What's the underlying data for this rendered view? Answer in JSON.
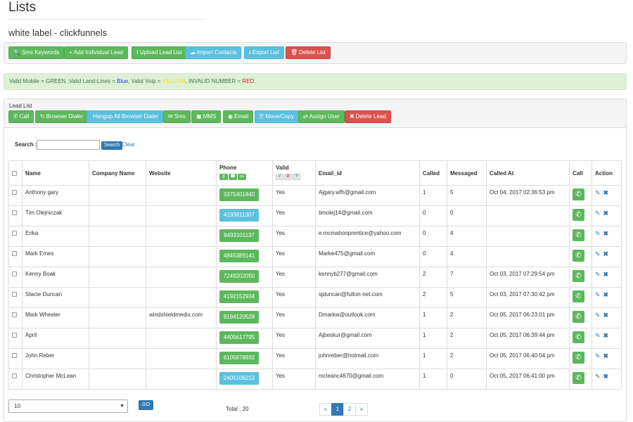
{
  "page": {
    "title": "Lists",
    "subtitle": "white label - clickfunnels"
  },
  "toolbar": [
    {
      "label": "Sms Keywords",
      "icon": "🔍",
      "color": "green"
    },
    {
      "label": "Add Individual Lead",
      "icon": "+",
      "color": "green"
    },
    {
      "label": "Upload Lead List",
      "icon": "⭱",
      "color": "green"
    },
    {
      "label": "Import Contacts",
      "icon": "☁",
      "color": "blue"
    },
    {
      "label": "Export List",
      "icon": "⭳",
      "color": "blue"
    },
    {
      "label": "Delete List",
      "icon": "🗑",
      "color": "red"
    }
  ],
  "legend": {
    "part1": "Valid Mobile = GREEN ,Valid Land-Lines = ",
    "blue": "Blue",
    "part2": ", Valid Voip = ",
    "yellow": "YELLOW",
    "part3": ", INVALID NUMBER = ",
    "red": "RED."
  },
  "lead_list": {
    "label": "Lead List",
    "buttons": [
      {
        "label": "Call",
        "icon": "✆",
        "color": "green"
      },
      {
        "label": "Browser Dialer",
        "icon": "↻",
        "color": "green"
      },
      {
        "label": "Hangup All Browser Dialer",
        "icon": "",
        "color": "blue"
      },
      {
        "label": "Sms",
        "icon": "✉",
        "color": "green"
      },
      {
        "label": "MMS",
        "icon": "▣",
        "color": "green"
      },
      {
        "label": "Email",
        "icon": "◉",
        "color": "green"
      },
      {
        "label": "Move/Copy",
        "icon": "⎘",
        "color": "blue"
      },
      {
        "label": "Assign User",
        "icon": "⇄",
        "color": "green"
      },
      {
        "label": "Delete Lead",
        "icon": "✖",
        "color": "red"
      }
    ]
  },
  "search": {
    "label": "Search :",
    "value": "",
    "button": "Search",
    "clear": "Clear"
  },
  "table": {
    "headers": {
      "name": "Name",
      "company": "Company Name",
      "website": "Website",
      "phone": "Phone",
      "valid": "Valid",
      "email": "Email_id",
      "called": "Called",
      "messaged": "Messaged",
      "called_at": "Called At",
      "call": "Call",
      "action": "Action"
    },
    "rows": [
      {
        "name": "Anthony gary",
        "company": "",
        "website": "",
        "phone": "3375401840",
        "phone_color": "#5cb85c",
        "valid": "Yes",
        "email": "Ajgary.wfh@gmail.com",
        "called": "1",
        "messaged": "5",
        "called_at": "Oct 04, 2017 02:36:53 pm"
      },
      {
        "name": "Tim Olejniczak",
        "company": "",
        "website": "",
        "phone": "4193811307",
        "phone_color": "#5bc0de",
        "valid": "Yes",
        "email": "timolej14@gmail.com",
        "called": "0",
        "messaged": "0",
        "called_at": ""
      },
      {
        "name": "Erika",
        "company": "",
        "website": "",
        "phone": "9493101137",
        "phone_color": "#5cb85c",
        "valid": "Yes",
        "email": "e.mcmahonprentice@yahoo.com",
        "called": "0",
        "messaged": "4",
        "called_at": ""
      },
      {
        "name": "Mark Emes",
        "company": "",
        "website": "",
        "phone": "4845389141",
        "phone_color": "#5cb85c",
        "valid": "Yes",
        "email": "Marke475@gmail.com",
        "called": "0",
        "messaged": "4",
        "called_at": ""
      },
      {
        "name": "Kenny Boak",
        "company": "",
        "website": "",
        "phone": "7249202050",
        "phone_color": "#5cb85c",
        "valid": "Yes",
        "email": "kennyb277@gmail.com",
        "called": "2",
        "messaged": "7",
        "called_at": "Oct 03, 2017 07:29:54 pm"
      },
      {
        "name": "Stacie Duncan",
        "company": "",
        "website": "",
        "phone": "4192152934",
        "phone_color": "#5cb85c",
        "valid": "Yes",
        "email": "sjduncan@fulton-net.com",
        "called": "2",
        "messaged": "5",
        "called_at": "Oct 03, 2017 07:30:42 pm"
      },
      {
        "name": "Mark Wheeler",
        "company": "",
        "website": "windshieldmedix.com",
        "phone": "9194120528",
        "phone_color": "#5cb85c",
        "valid": "Yes",
        "email": "Dmarkw@outlook.com",
        "called": "1",
        "messaged": "2",
        "called_at": "Oct 05, 2017 06:23:01 pm"
      },
      {
        "name": "April",
        "company": "",
        "website": "",
        "phone": "4405617795",
        "phone_color": "#5cb85c",
        "valid": "Yes",
        "email": "Ajbeskur@gmail.com",
        "called": "1",
        "messaged": "2",
        "called_at": "Oct 05, 2017 06:39:44 pm"
      },
      {
        "name": "John Reber",
        "company": "",
        "website": "",
        "phone": "6105878932",
        "phone_color": "#5cb85c",
        "valid": "Yes",
        "email": "johnreber@hotmail.com",
        "called": "1",
        "messaged": "2",
        "called_at": "Oct 05, 2017 06:40:04 pm"
      },
      {
        "name": "Christopher McLean",
        "company": "",
        "website": "",
        "phone": "2405106213",
        "phone_color": "#5bc0de",
        "valid": "Yes",
        "email": "mcleanc4670@gmail.com",
        "called": "1",
        "messaged": "0",
        "called_at": "Oct 05, 2017 06:41:00 pm"
      }
    ]
  },
  "footer": {
    "page_size": "10",
    "go": "GO",
    "total": "Total : 20",
    "pages": [
      "«",
      "1",
      "2",
      "»"
    ],
    "active_page": "1"
  }
}
